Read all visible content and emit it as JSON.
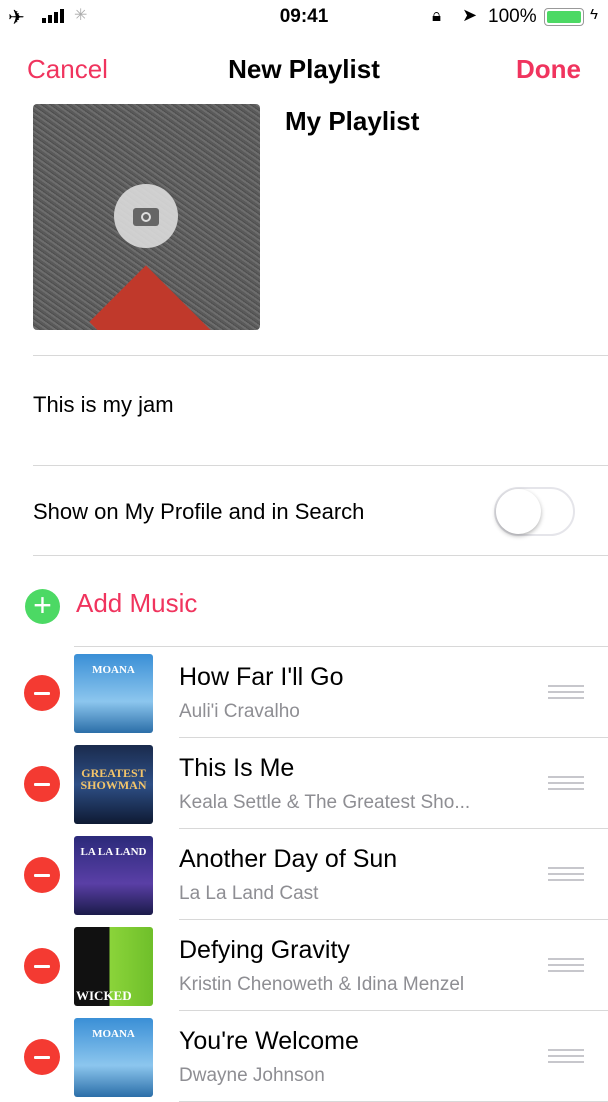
{
  "status": {
    "time": "09:41",
    "battery": "100%",
    "battery_level": 1.0,
    "battery_color": "#4cd964"
  },
  "nav": {
    "cancel": "Cancel",
    "title": "New Playlist",
    "done": "Done"
  },
  "playlist": {
    "name": "My Playlist",
    "description": "This is my jam",
    "camera_icon": "camera-icon"
  },
  "profile_toggle": {
    "label": "Show on My Profile and in Search",
    "on": false
  },
  "add_music": {
    "label": "Add Music",
    "color": "#4cd964"
  },
  "accent": "#f0345e",
  "songs": [
    {
      "title": "How Far I'll Go",
      "artist": "Auli'i Cravalho",
      "art_text": "MOANA"
    },
    {
      "title": "This Is Me",
      "artist": "Keala Settle & The Greatest Sho...",
      "art_text": "GREATEST SHOWMAN"
    },
    {
      "title": "Another Day of Sun",
      "artist": "La La Land Cast",
      "art_text": "LA LA LAND"
    },
    {
      "title": "Defying Gravity",
      "artist": "Kristin Chenoweth & Idina Menzel",
      "art_text": "WICKED"
    },
    {
      "title": "You're Welcome",
      "artist": "Dwayne Johnson",
      "art_text": "MOANA"
    }
  ]
}
